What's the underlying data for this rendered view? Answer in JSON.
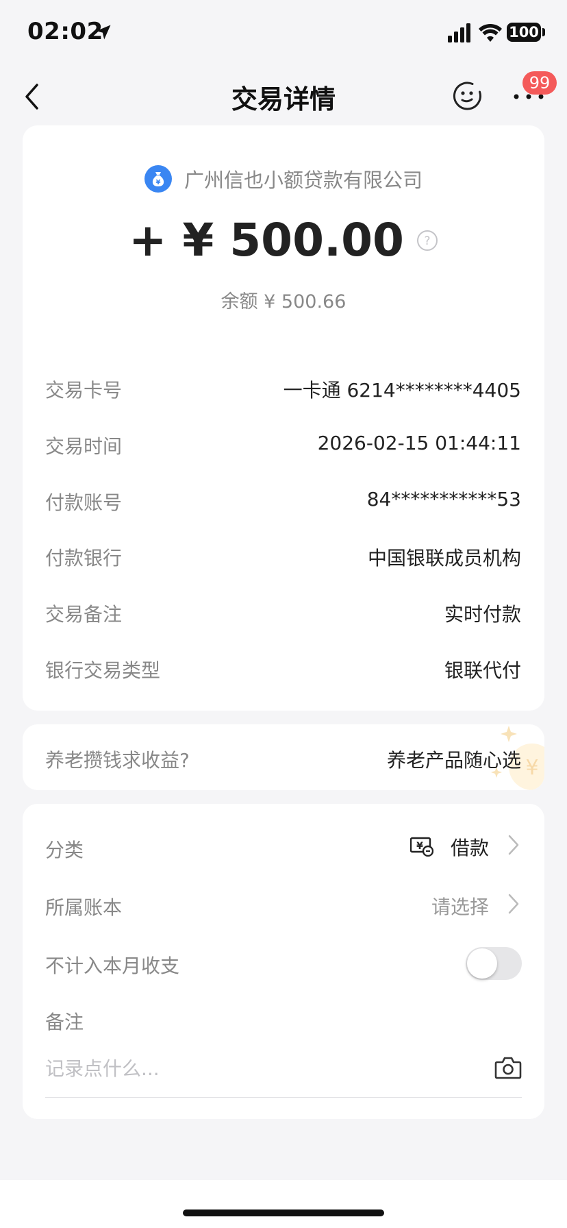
{
  "status_bar": {
    "time": "02:02",
    "battery": "100"
  },
  "nav": {
    "title": "交易详情",
    "badge": "99"
  },
  "transaction": {
    "merchant": "广州信也小额贷款有限公司",
    "amount": "+ ¥ 500.00",
    "balance": "余额 ¥ 500.66"
  },
  "details": [
    {
      "label": "交易卡号",
      "value": "一卡通 6214********4405"
    },
    {
      "label": "交易时间",
      "value": "2026-02-15 01:44:11"
    },
    {
      "label": "付款账号",
      "value": "84***********53"
    },
    {
      "label": "付款银行",
      "value": "中国银联成员机构"
    },
    {
      "label": "交易备注",
      "value": "实时付款"
    },
    {
      "label": "银行交易类型",
      "value": "银联代付"
    }
  ],
  "promo": {
    "question": "养老攒钱求收益?",
    "action": "养老产品随心选"
  },
  "settings": {
    "category_label": "分类",
    "category_value": "借款",
    "book_label": "所属账本",
    "book_value": "请选择",
    "exclude_label": "不计入本月收支",
    "exclude_enabled": false,
    "remark_label": "备注",
    "remark_placeholder": "记录点什么..."
  },
  "colors": {
    "accent_blue": "#3a86f2",
    "badge_red": "#f45a5a",
    "page_bg": "#f5f5f7"
  },
  "icons": [
    "location-arrow-icon",
    "signal-icon",
    "wifi-icon",
    "back-chevron-icon",
    "customer-service-icon",
    "more-dots-icon",
    "money-bag-icon",
    "help-circle-icon",
    "loan-category-icon",
    "chevron-right-icon",
    "camera-icon"
  ]
}
